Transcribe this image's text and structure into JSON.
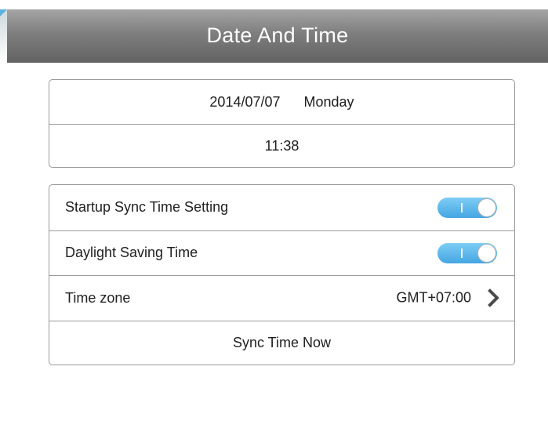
{
  "header": {
    "title": "Date And Time"
  },
  "datetime": {
    "date": "2014/07/07",
    "weekday": "Monday",
    "time": "11:38"
  },
  "settings": {
    "startup_sync": {
      "label": "Startup Sync Time Setting",
      "enabled": true
    },
    "daylight_saving": {
      "label": "Daylight Saving Time",
      "enabled": true
    },
    "time_zone": {
      "label": "Time zone",
      "value": "GMT+07:00"
    },
    "sync_now": {
      "label": "Sync Time Now"
    }
  },
  "colors": {
    "toggle_on": "#44a6e2",
    "title_bar": "#7e7e7e"
  },
  "icons": {
    "time_zone_arrow": "chevron-right-icon"
  }
}
